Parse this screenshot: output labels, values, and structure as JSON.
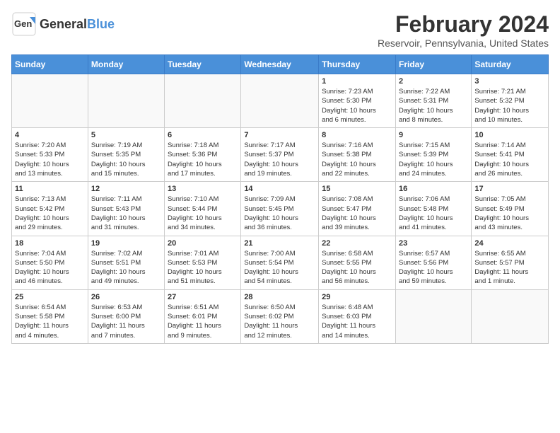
{
  "app": {
    "logo_general": "General",
    "logo_blue": "Blue",
    "month_year": "February 2024",
    "location": "Reservoir, Pennsylvania, United States"
  },
  "calendar": {
    "headers": [
      "Sunday",
      "Monday",
      "Tuesday",
      "Wednesday",
      "Thursday",
      "Friday",
      "Saturday"
    ],
    "weeks": [
      [
        {
          "day": "",
          "info": ""
        },
        {
          "day": "",
          "info": ""
        },
        {
          "day": "",
          "info": ""
        },
        {
          "day": "",
          "info": ""
        },
        {
          "day": "1",
          "info": "Sunrise: 7:23 AM\nSunset: 5:30 PM\nDaylight: 10 hours\nand 6 minutes."
        },
        {
          "day": "2",
          "info": "Sunrise: 7:22 AM\nSunset: 5:31 PM\nDaylight: 10 hours\nand 8 minutes."
        },
        {
          "day": "3",
          "info": "Sunrise: 7:21 AM\nSunset: 5:32 PM\nDaylight: 10 hours\nand 10 minutes."
        }
      ],
      [
        {
          "day": "4",
          "info": "Sunrise: 7:20 AM\nSunset: 5:33 PM\nDaylight: 10 hours\nand 13 minutes."
        },
        {
          "day": "5",
          "info": "Sunrise: 7:19 AM\nSunset: 5:35 PM\nDaylight: 10 hours\nand 15 minutes."
        },
        {
          "day": "6",
          "info": "Sunrise: 7:18 AM\nSunset: 5:36 PM\nDaylight: 10 hours\nand 17 minutes."
        },
        {
          "day": "7",
          "info": "Sunrise: 7:17 AM\nSunset: 5:37 PM\nDaylight: 10 hours\nand 19 minutes."
        },
        {
          "day": "8",
          "info": "Sunrise: 7:16 AM\nSunset: 5:38 PM\nDaylight: 10 hours\nand 22 minutes."
        },
        {
          "day": "9",
          "info": "Sunrise: 7:15 AM\nSunset: 5:39 PM\nDaylight: 10 hours\nand 24 minutes."
        },
        {
          "day": "10",
          "info": "Sunrise: 7:14 AM\nSunset: 5:41 PM\nDaylight: 10 hours\nand 26 minutes."
        }
      ],
      [
        {
          "day": "11",
          "info": "Sunrise: 7:13 AM\nSunset: 5:42 PM\nDaylight: 10 hours\nand 29 minutes."
        },
        {
          "day": "12",
          "info": "Sunrise: 7:11 AM\nSunset: 5:43 PM\nDaylight: 10 hours\nand 31 minutes."
        },
        {
          "day": "13",
          "info": "Sunrise: 7:10 AM\nSunset: 5:44 PM\nDaylight: 10 hours\nand 34 minutes."
        },
        {
          "day": "14",
          "info": "Sunrise: 7:09 AM\nSunset: 5:45 PM\nDaylight: 10 hours\nand 36 minutes."
        },
        {
          "day": "15",
          "info": "Sunrise: 7:08 AM\nSunset: 5:47 PM\nDaylight: 10 hours\nand 39 minutes."
        },
        {
          "day": "16",
          "info": "Sunrise: 7:06 AM\nSunset: 5:48 PM\nDaylight: 10 hours\nand 41 minutes."
        },
        {
          "day": "17",
          "info": "Sunrise: 7:05 AM\nSunset: 5:49 PM\nDaylight: 10 hours\nand 43 minutes."
        }
      ],
      [
        {
          "day": "18",
          "info": "Sunrise: 7:04 AM\nSunset: 5:50 PM\nDaylight: 10 hours\nand 46 minutes."
        },
        {
          "day": "19",
          "info": "Sunrise: 7:02 AM\nSunset: 5:51 PM\nDaylight: 10 hours\nand 49 minutes."
        },
        {
          "day": "20",
          "info": "Sunrise: 7:01 AM\nSunset: 5:53 PM\nDaylight: 10 hours\nand 51 minutes."
        },
        {
          "day": "21",
          "info": "Sunrise: 7:00 AM\nSunset: 5:54 PM\nDaylight: 10 hours\nand 54 minutes."
        },
        {
          "day": "22",
          "info": "Sunrise: 6:58 AM\nSunset: 5:55 PM\nDaylight: 10 hours\nand 56 minutes."
        },
        {
          "day": "23",
          "info": "Sunrise: 6:57 AM\nSunset: 5:56 PM\nDaylight: 10 hours\nand 59 minutes."
        },
        {
          "day": "24",
          "info": "Sunrise: 6:55 AM\nSunset: 5:57 PM\nDaylight: 11 hours\nand 1 minute."
        }
      ],
      [
        {
          "day": "25",
          "info": "Sunrise: 6:54 AM\nSunset: 5:58 PM\nDaylight: 11 hours\nand 4 minutes."
        },
        {
          "day": "26",
          "info": "Sunrise: 6:53 AM\nSunset: 6:00 PM\nDaylight: 11 hours\nand 7 minutes."
        },
        {
          "day": "27",
          "info": "Sunrise: 6:51 AM\nSunset: 6:01 PM\nDaylight: 11 hours\nand 9 minutes."
        },
        {
          "day": "28",
          "info": "Sunrise: 6:50 AM\nSunset: 6:02 PM\nDaylight: 11 hours\nand 12 minutes."
        },
        {
          "day": "29",
          "info": "Sunrise: 6:48 AM\nSunset: 6:03 PM\nDaylight: 11 hours\nand 14 minutes."
        },
        {
          "day": "",
          "info": ""
        },
        {
          "day": "",
          "info": ""
        }
      ]
    ]
  }
}
